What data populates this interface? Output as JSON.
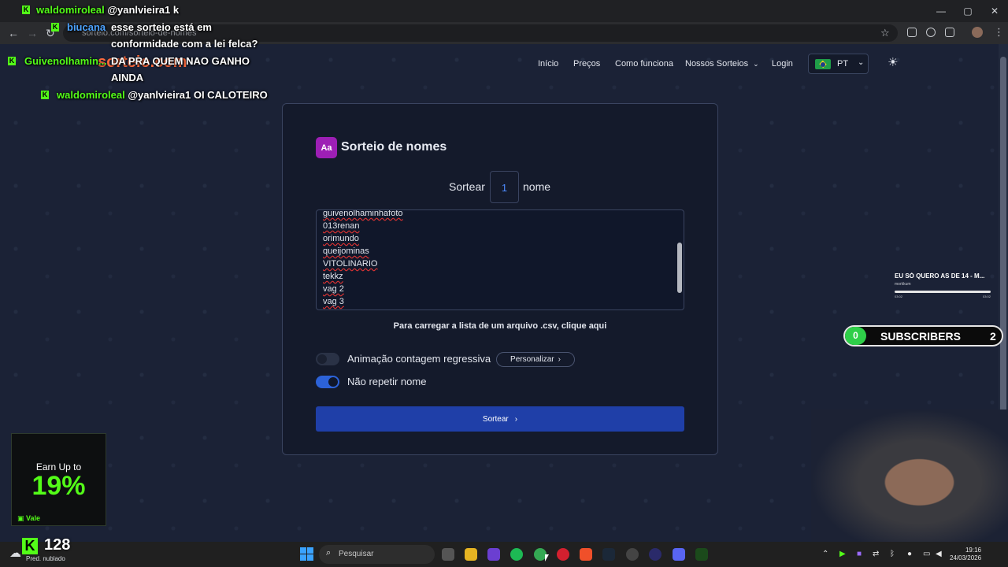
{
  "browser": {
    "url": "sorteio.com/sorteio-de-nomes",
    "window_controls": [
      "—",
      "▢",
      "✕"
    ]
  },
  "site": {
    "logo": "sorteio.com",
    "nav": [
      "Início",
      "Preços",
      "Como funciona",
      "Nossos Sorteios",
      "Login"
    ],
    "language": "PT"
  },
  "card": {
    "icon_text": "Aa",
    "title": "Sorteio de nomes",
    "draw_prefix": "Sortear",
    "draw_count": "1",
    "draw_suffix": "nome",
    "names": [
      "guivenolhaminhafoto",
      "013renan",
      "orimundo",
      "queijominas",
      "VITOLINARIO",
      "tekkz",
      "vag 2",
      "vag 3"
    ],
    "csv_text": "Para carregar a lista de um arquivo .csv, clique aqui",
    "countdown_label": "Animação contagem regressiva",
    "countdown_on": false,
    "customize_label": "Personalizar",
    "no_repeat_label": "Não repetir nome",
    "no_repeat_on": true,
    "draw_button": "Sortear"
  },
  "stream": {
    "chat": [
      {
        "user": "waldomiroleal",
        "message": "@yanlvieira1 k"
      },
      {
        "user": "biucana",
        "message": "esse sorteio está em"
      },
      {
        "user": "",
        "message": "conformidade com a lei felca?"
      },
      {
        "user": "Guivenolhamin...",
        "message": "DA PRA QUEM NAO GANHO"
      },
      {
        "user": "",
        "message": "AINDA"
      },
      {
        "user": "waldomiroleal",
        "message": "@yanlvieira1 OI CALOTEIRO"
      }
    ],
    "music": {
      "title": "EU SÓ QUERO AS DE 14 - M...",
      "artist": "morkkum",
      "progress": 1.0,
      "time_current": "03:02",
      "time_total": "03:02"
    },
    "subscribers": {
      "count": "0",
      "label": "SUBSCRIBERS",
      "goal": "2"
    },
    "promo": {
      "line1": "Earn Up to",
      "line2": "19%",
      "brand": "Vale"
    },
    "viewers": "128"
  },
  "taskbar": {
    "weather": "Pred. nublado",
    "search_placeholder": "Pesquisar",
    "time": "19:16",
    "date": "24/03/2026"
  },
  "colors": {
    "page_bg": "#1b2236",
    "card_bg": "#141a2b",
    "accent_blue": "#1f3fa8",
    "kick_green": "#53fc18",
    "logo_orange": "#ff6b3d",
    "icon_purple": "#9d1fb5"
  }
}
